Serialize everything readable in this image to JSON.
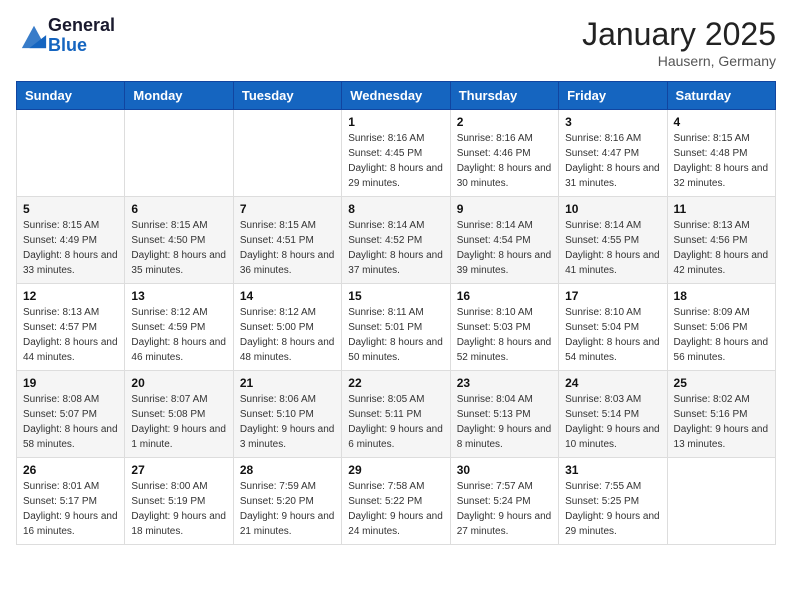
{
  "header": {
    "logo_general": "General",
    "logo_blue": "Blue",
    "month_title": "January 2025",
    "location": "Hausern, Germany"
  },
  "weekdays": [
    "Sunday",
    "Monday",
    "Tuesday",
    "Wednesday",
    "Thursday",
    "Friday",
    "Saturday"
  ],
  "weeks": [
    [
      {
        "day": "",
        "sunrise": "",
        "sunset": "",
        "daylight": ""
      },
      {
        "day": "",
        "sunrise": "",
        "sunset": "",
        "daylight": ""
      },
      {
        "day": "",
        "sunrise": "",
        "sunset": "",
        "daylight": ""
      },
      {
        "day": "1",
        "sunrise": "Sunrise: 8:16 AM",
        "sunset": "Sunset: 4:45 PM",
        "daylight": "Daylight: 8 hours and 29 minutes."
      },
      {
        "day": "2",
        "sunrise": "Sunrise: 8:16 AM",
        "sunset": "Sunset: 4:46 PM",
        "daylight": "Daylight: 8 hours and 30 minutes."
      },
      {
        "day": "3",
        "sunrise": "Sunrise: 8:16 AM",
        "sunset": "Sunset: 4:47 PM",
        "daylight": "Daylight: 8 hours and 31 minutes."
      },
      {
        "day": "4",
        "sunrise": "Sunrise: 8:15 AM",
        "sunset": "Sunset: 4:48 PM",
        "daylight": "Daylight: 8 hours and 32 minutes."
      }
    ],
    [
      {
        "day": "5",
        "sunrise": "Sunrise: 8:15 AM",
        "sunset": "Sunset: 4:49 PM",
        "daylight": "Daylight: 8 hours and 33 minutes."
      },
      {
        "day": "6",
        "sunrise": "Sunrise: 8:15 AM",
        "sunset": "Sunset: 4:50 PM",
        "daylight": "Daylight: 8 hours and 35 minutes."
      },
      {
        "day": "7",
        "sunrise": "Sunrise: 8:15 AM",
        "sunset": "Sunset: 4:51 PM",
        "daylight": "Daylight: 8 hours and 36 minutes."
      },
      {
        "day": "8",
        "sunrise": "Sunrise: 8:14 AM",
        "sunset": "Sunset: 4:52 PM",
        "daylight": "Daylight: 8 hours and 37 minutes."
      },
      {
        "day": "9",
        "sunrise": "Sunrise: 8:14 AM",
        "sunset": "Sunset: 4:54 PM",
        "daylight": "Daylight: 8 hours and 39 minutes."
      },
      {
        "day": "10",
        "sunrise": "Sunrise: 8:14 AM",
        "sunset": "Sunset: 4:55 PM",
        "daylight": "Daylight: 8 hours and 41 minutes."
      },
      {
        "day": "11",
        "sunrise": "Sunrise: 8:13 AM",
        "sunset": "Sunset: 4:56 PM",
        "daylight": "Daylight: 8 hours and 42 minutes."
      }
    ],
    [
      {
        "day": "12",
        "sunrise": "Sunrise: 8:13 AM",
        "sunset": "Sunset: 4:57 PM",
        "daylight": "Daylight: 8 hours and 44 minutes."
      },
      {
        "day": "13",
        "sunrise": "Sunrise: 8:12 AM",
        "sunset": "Sunset: 4:59 PM",
        "daylight": "Daylight: 8 hours and 46 minutes."
      },
      {
        "day": "14",
        "sunrise": "Sunrise: 8:12 AM",
        "sunset": "Sunset: 5:00 PM",
        "daylight": "Daylight: 8 hours and 48 minutes."
      },
      {
        "day": "15",
        "sunrise": "Sunrise: 8:11 AM",
        "sunset": "Sunset: 5:01 PM",
        "daylight": "Daylight: 8 hours and 50 minutes."
      },
      {
        "day": "16",
        "sunrise": "Sunrise: 8:10 AM",
        "sunset": "Sunset: 5:03 PM",
        "daylight": "Daylight: 8 hours and 52 minutes."
      },
      {
        "day": "17",
        "sunrise": "Sunrise: 8:10 AM",
        "sunset": "Sunset: 5:04 PM",
        "daylight": "Daylight: 8 hours and 54 minutes."
      },
      {
        "day": "18",
        "sunrise": "Sunrise: 8:09 AM",
        "sunset": "Sunset: 5:06 PM",
        "daylight": "Daylight: 8 hours and 56 minutes."
      }
    ],
    [
      {
        "day": "19",
        "sunrise": "Sunrise: 8:08 AM",
        "sunset": "Sunset: 5:07 PM",
        "daylight": "Daylight: 8 hours and 58 minutes."
      },
      {
        "day": "20",
        "sunrise": "Sunrise: 8:07 AM",
        "sunset": "Sunset: 5:08 PM",
        "daylight": "Daylight: 9 hours and 1 minute."
      },
      {
        "day": "21",
        "sunrise": "Sunrise: 8:06 AM",
        "sunset": "Sunset: 5:10 PM",
        "daylight": "Daylight: 9 hours and 3 minutes."
      },
      {
        "day": "22",
        "sunrise": "Sunrise: 8:05 AM",
        "sunset": "Sunset: 5:11 PM",
        "daylight": "Daylight: 9 hours and 6 minutes."
      },
      {
        "day": "23",
        "sunrise": "Sunrise: 8:04 AM",
        "sunset": "Sunset: 5:13 PM",
        "daylight": "Daylight: 9 hours and 8 minutes."
      },
      {
        "day": "24",
        "sunrise": "Sunrise: 8:03 AM",
        "sunset": "Sunset: 5:14 PM",
        "daylight": "Daylight: 9 hours and 10 minutes."
      },
      {
        "day": "25",
        "sunrise": "Sunrise: 8:02 AM",
        "sunset": "Sunset: 5:16 PM",
        "daylight": "Daylight: 9 hours and 13 minutes."
      }
    ],
    [
      {
        "day": "26",
        "sunrise": "Sunrise: 8:01 AM",
        "sunset": "Sunset: 5:17 PM",
        "daylight": "Daylight: 9 hours and 16 minutes."
      },
      {
        "day": "27",
        "sunrise": "Sunrise: 8:00 AM",
        "sunset": "Sunset: 5:19 PM",
        "daylight": "Daylight: 9 hours and 18 minutes."
      },
      {
        "day": "28",
        "sunrise": "Sunrise: 7:59 AM",
        "sunset": "Sunset: 5:20 PM",
        "daylight": "Daylight: 9 hours and 21 minutes."
      },
      {
        "day": "29",
        "sunrise": "Sunrise: 7:58 AM",
        "sunset": "Sunset: 5:22 PM",
        "daylight": "Daylight: 9 hours and 24 minutes."
      },
      {
        "day": "30",
        "sunrise": "Sunrise: 7:57 AM",
        "sunset": "Sunset: 5:24 PM",
        "daylight": "Daylight: 9 hours and 27 minutes."
      },
      {
        "day": "31",
        "sunrise": "Sunrise: 7:55 AM",
        "sunset": "Sunset: 5:25 PM",
        "daylight": "Daylight: 9 hours and 29 minutes."
      },
      {
        "day": "",
        "sunrise": "",
        "sunset": "",
        "daylight": ""
      }
    ]
  ]
}
